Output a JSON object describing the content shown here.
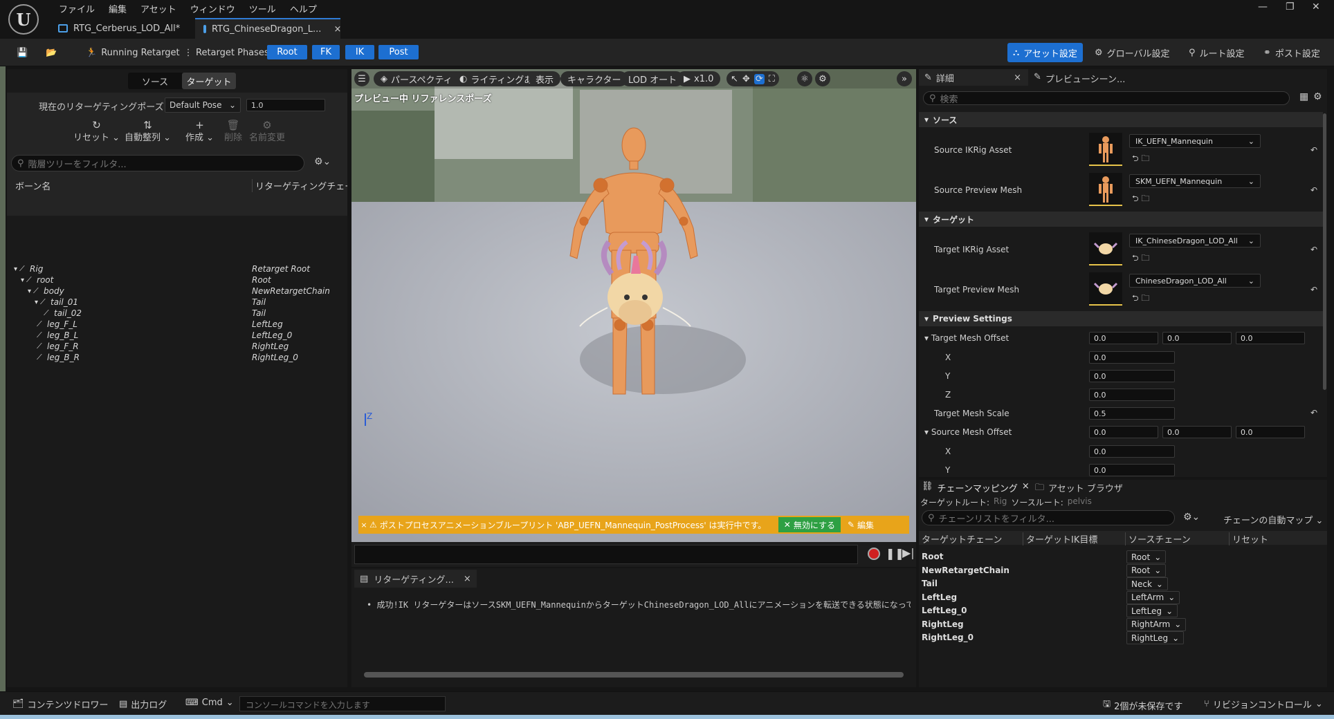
{
  "menu": [
    "ファイル",
    "編集",
    "アセット",
    "ウィンドウ",
    "ツール",
    "ヘルプ"
  ],
  "tabs": [
    {
      "label": "RTG_Cerberus_LOD_All*",
      "active": false
    },
    {
      "label": "RTG_ChineseDragon_L...",
      "active": true,
      "close": "×"
    }
  ],
  "toolbar": {
    "running_retarget": "Running Retarget",
    "phases_label": "Retarget Phases:",
    "phases": [
      "Root",
      "FK",
      "IK",
      "Post"
    ],
    "right_buttons": [
      {
        "label": "アセット設定",
        "active": true
      },
      {
        "label": "グローバル設定",
        "active": false
      },
      {
        "label": "ルート設定",
        "active": false
      },
      {
        "label": "ポスト設定",
        "active": false
      }
    ]
  },
  "left": {
    "seg": [
      "ソース",
      "ターゲット"
    ],
    "pose_label": "現在のリターゲティングポーズ:",
    "pose_value": "Default Pose",
    "pose_blend": "1.0",
    "actions": [
      {
        "label": "リセット",
        "icon": "↻",
        "enabled": true
      },
      {
        "label": "自動整列",
        "icon": "⇅",
        "enabled": true
      },
      {
        "label": "作成",
        "icon": "+",
        "enabled": true
      },
      {
        "label": "削除",
        "icon": "🗑",
        "enabled": false
      },
      {
        "label": "名前変更",
        "icon": "⚙",
        "enabled": false
      }
    ],
    "filter_placeholder": "階層ツリーをフィルタ...",
    "col_bone": "ボーン名",
    "col_chain": "リターゲティングチェーン",
    "tree": [
      {
        "name": "Rig",
        "chain": "Retarget Root",
        "indent": 0
      },
      {
        "name": "root",
        "chain": "Root",
        "indent": 1
      },
      {
        "name": "body",
        "chain": "NewRetargetChain",
        "indent": 2
      },
      {
        "name": "tail_01",
        "chain": "Tail",
        "indent": 3
      },
      {
        "name": "tail_02",
        "chain": "Tail",
        "indent": 4
      },
      {
        "name": "leg_F_L",
        "chain": "LeftLeg",
        "indent": 3
      },
      {
        "name": "leg_B_L",
        "chain": "LeftLeg_0",
        "indent": 3
      },
      {
        "name": "leg_F_R",
        "chain": "RightLeg",
        "indent": 3
      },
      {
        "name": "leg_B_R",
        "chain": "RightLeg_0",
        "indent": 3
      }
    ]
  },
  "viewport": {
    "perspective": "パースペクティブ",
    "lighting": "ライティングあり",
    "show": "表示",
    "character": "キャラクター",
    "lod": "LOD オート",
    "speed": "x1.0",
    "caption": "プレビュー中 リファレンスポーズ",
    "axis": "Z",
    "banner_text": "ポストプロセスアニメーションブループリント 'ABP_UEFN_Mannequin_PostProcess' は実行中です。",
    "banner_disable": "無効にする",
    "banner_edit": "編集"
  },
  "log": {
    "tab": "リターゲティング...",
    "message": "成功!IK リターゲターはソースSKM_UEFN_MannequinからターゲットChineseDragon_LOD_Allにアニメーションを転送できる状態になっています。"
  },
  "details": {
    "tab1": "詳細",
    "tab2": "プレビューシーン...",
    "search_placeholder": "検索",
    "source_section": "ソース",
    "source_ikrig_label": "Source IKRig Asset",
    "source_ikrig": "IK_UEFN_Mannequin",
    "source_mesh_label": "Source Preview Mesh",
    "source_mesh": "SKM_UEFN_Mannequin",
    "target_section": "ターゲット",
    "target_ikrig_label": "Target IKRig Asset",
    "target_ikrig": "IK_ChineseDragon_LOD_All",
    "target_mesh_label": "Target Preview Mesh",
    "target_mesh": "ChineseDragon_LOD_All",
    "preview_section": "Preview Settings",
    "tmo_label": "Target Mesh Offset",
    "tmo": [
      "0.0",
      "0.0",
      "0.0"
    ],
    "x": "X",
    "y": "Y",
    "z": "Z",
    "tmo_x": "0.0",
    "tmo_y": "0.0",
    "tmo_z": "0.0",
    "tms_label": "Target Mesh Scale",
    "tms": "0.5",
    "smo_label": "Source Mesh Offset",
    "smo": [
      "0.0",
      "0.0",
      "0.0"
    ],
    "smo_x": "0.0",
    "smo_y": "0.0"
  },
  "chain": {
    "tab1": "チェーンマッピング",
    "tab2": "アセット ブラウザ",
    "target_root_label": "ターゲットルート:",
    "target_root": "Rig",
    "source_root_label": "ソースルート:",
    "source_root": "pelvis",
    "filter_placeholder": "チェーンリストをフィルタ...",
    "automap": "チェーンの自動マップ",
    "cols": [
      "ターゲットチェーン",
      "ターゲットIK目標",
      "ソースチェーン",
      "リセット"
    ],
    "rows": [
      {
        "target": "Root",
        "source": "Root"
      },
      {
        "target": "NewRetargetChain",
        "source": "Root"
      },
      {
        "target": "Tail",
        "source": "Neck"
      },
      {
        "target": "LeftLeg",
        "source": "LeftArm"
      },
      {
        "target": "LeftLeg_0",
        "source": "LeftLeg"
      },
      {
        "target": "RightLeg",
        "source": "RightArm"
      },
      {
        "target": "RightLeg_0",
        "source": "RightLeg"
      }
    ]
  },
  "status": {
    "content_drawer": "コンテンツドロワー",
    "output_log": "出力ログ",
    "cmd": "Cmd",
    "console_placeholder": "コンソールコマンドを入力します",
    "unsaved": "2個が未保存です",
    "revision": "リビジョンコントロール"
  }
}
